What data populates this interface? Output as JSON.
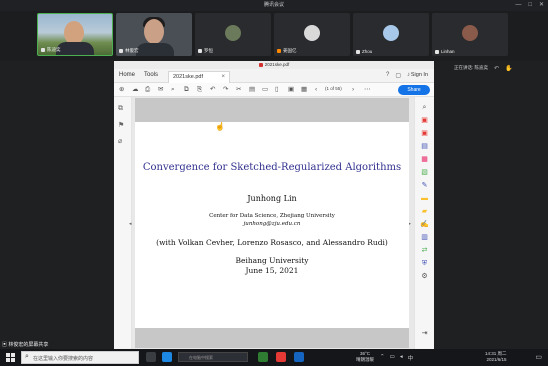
{
  "meeting": {
    "title": "腾讯会议",
    "side_status": "正在讲话: 陈迪奕"
  },
  "participants": [
    {
      "name": "陈迪奕"
    },
    {
      "name": "林俊宏"
    },
    {
      "name": "罗恒"
    },
    {
      "name": "姜国亿"
    },
    {
      "name": "Zhou"
    },
    {
      "name": "Linhan"
    }
  ],
  "pdf": {
    "window_title": "2021ske.pdf",
    "menu": {
      "home": "Home",
      "tools": "Tools"
    },
    "tab_label": "2021ske.pdf",
    "sign_in": "Sign In",
    "page_indicator": "(1 of 55)",
    "share_label": "Share"
  },
  "paper": {
    "title": "Convergence for Sketched-Regularized Algorithms",
    "author": "Junhong Lin",
    "affiliation": "Center for Data Science, Zhejiang University",
    "email": "junhong@zju.edu.cn",
    "collaborators": "(with Volkan Cevher, Lorenzo Rosasco, and Alessandro Rudi)",
    "venue": "Beihang University",
    "date": "June 15, 2021"
  },
  "sharer_label": "林俊宏的屏幕共享",
  "taskbar": {
    "search_placeholder": "在这里输入你要搜索的内容",
    "app_search_placeholder": "在电脑中搜索",
    "weather_temp": "36°C",
    "weather_desc": "晴朗温暖",
    "time": "14:31 周二",
    "date": "2021/6/15"
  },
  "colors": {
    "title_blue": "#30308e",
    "share_button": "#1473e6",
    "active_border": "#4caf50"
  }
}
